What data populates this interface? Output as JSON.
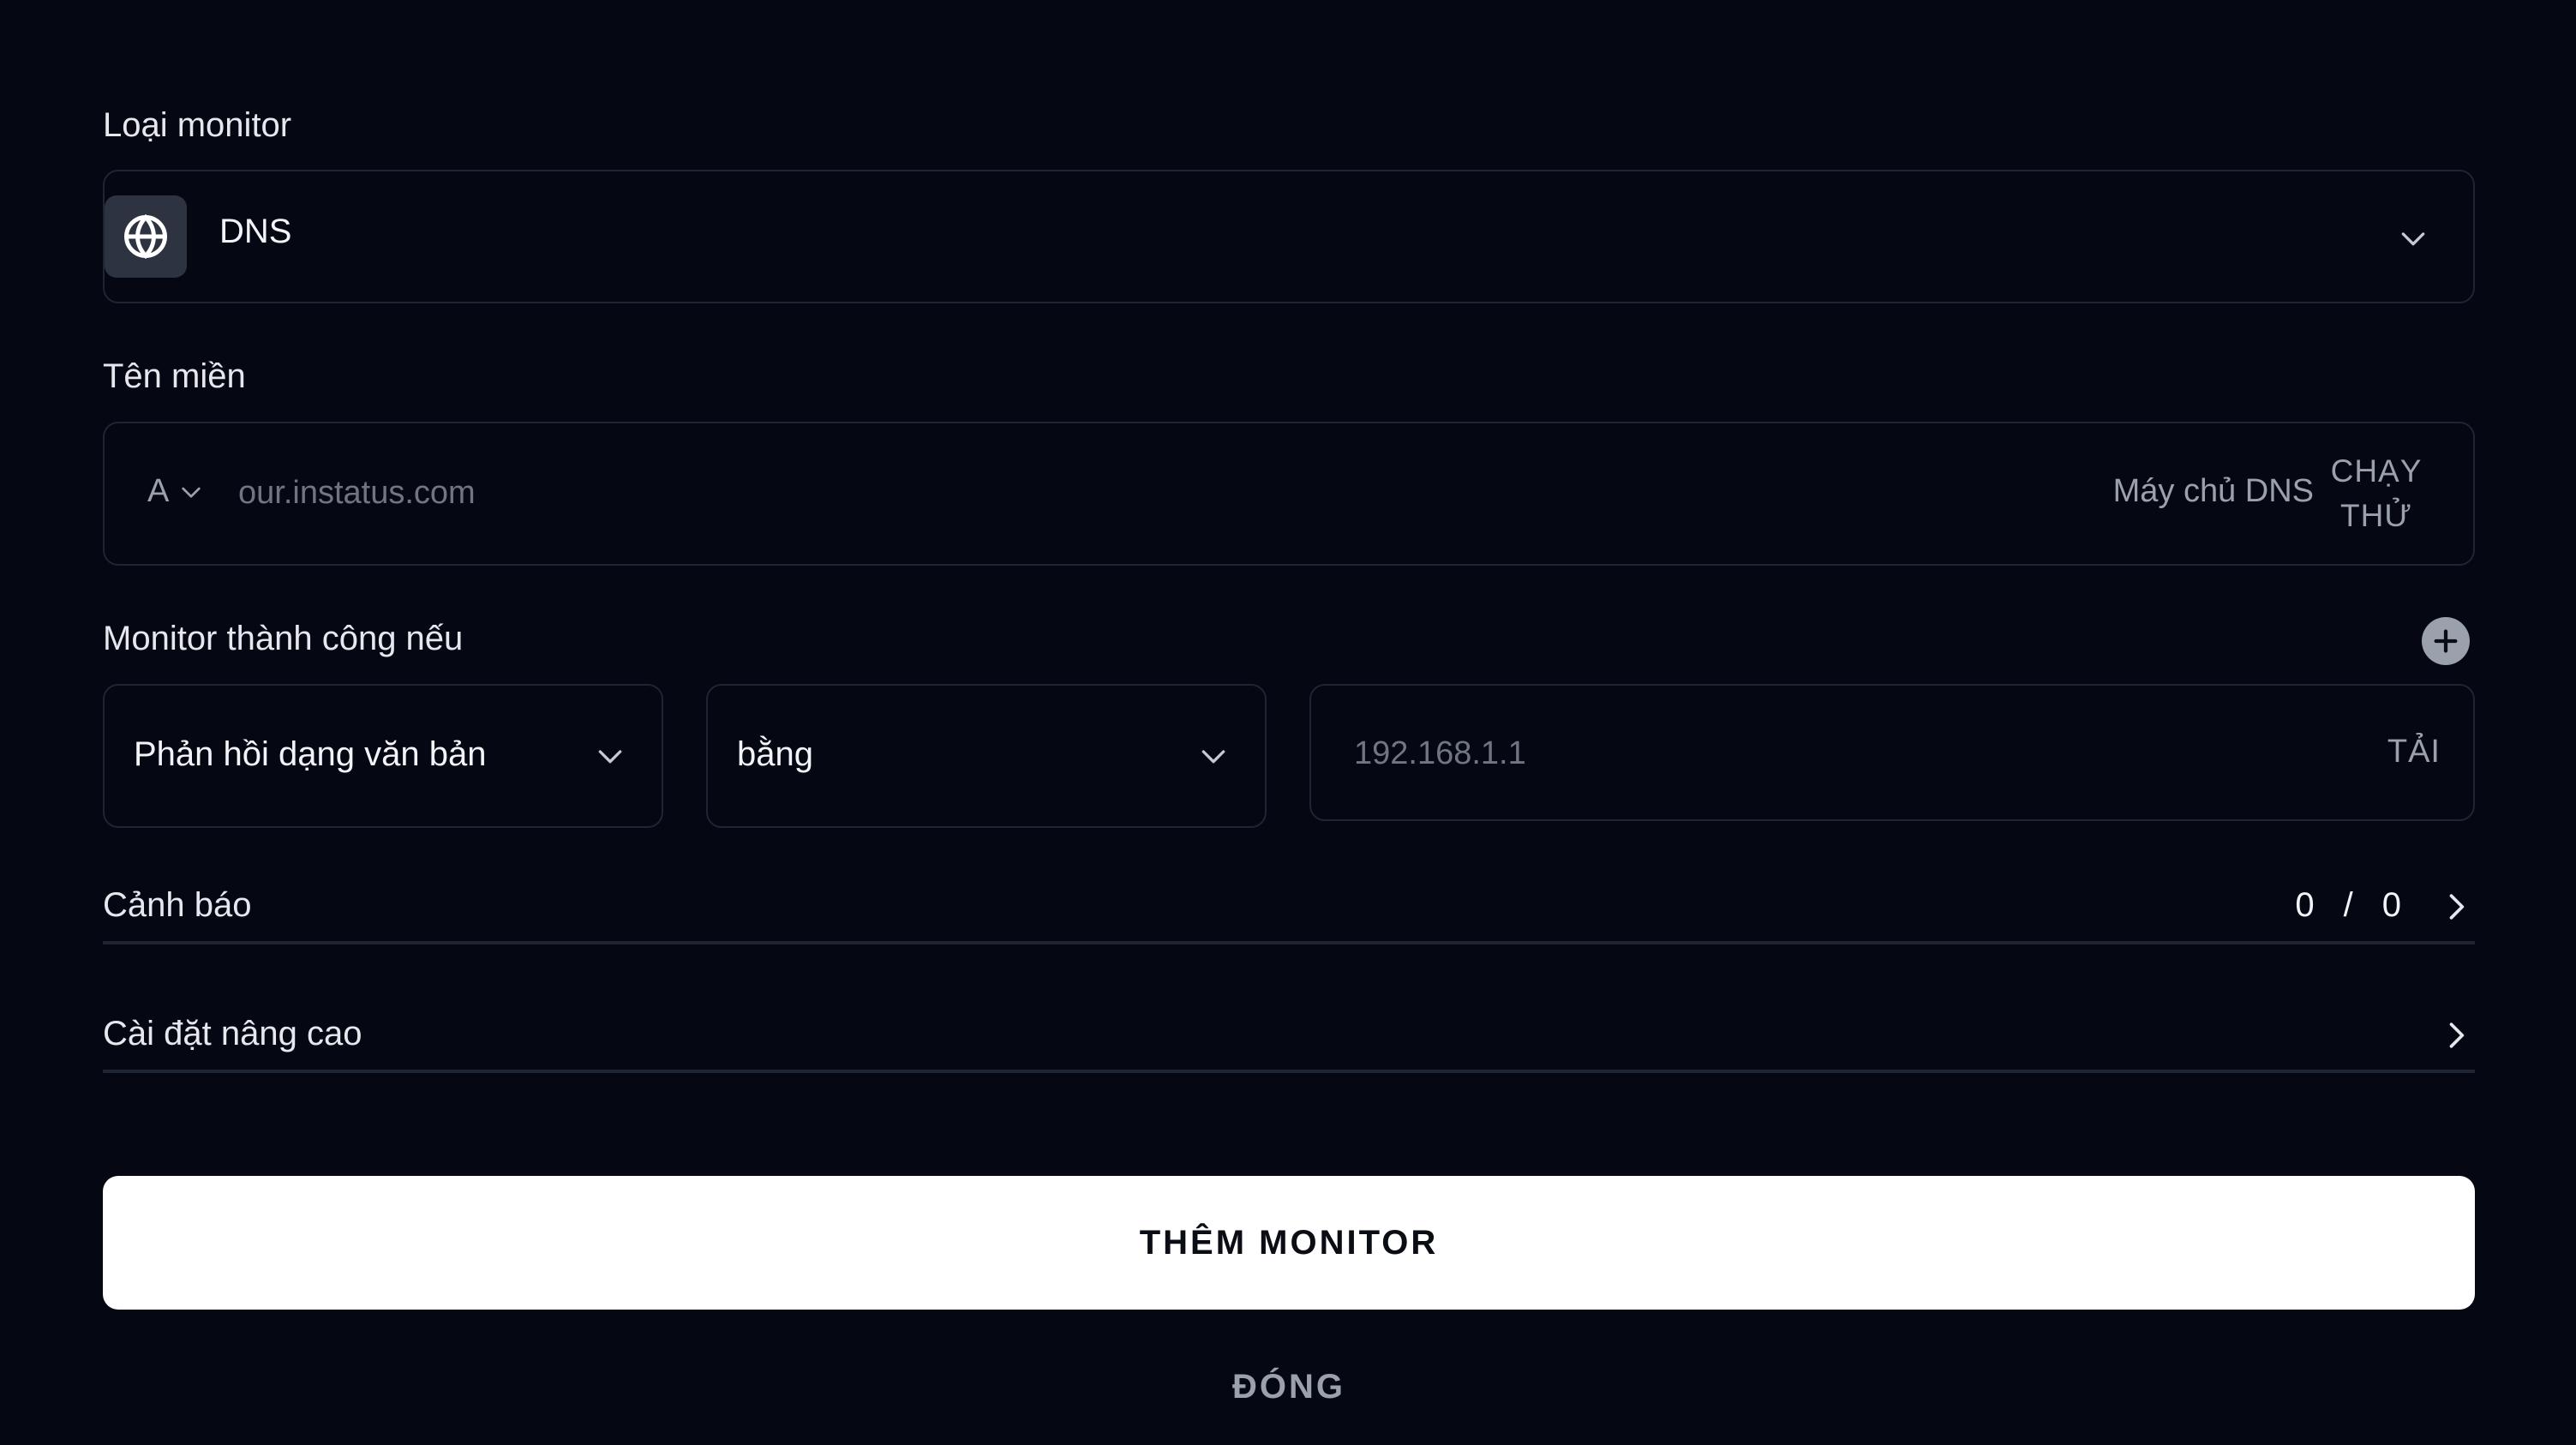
{
  "monitor_type": {
    "label": "Loại monitor",
    "value": "DNS",
    "icon": "globe-icon"
  },
  "domain": {
    "label": "Tên miền",
    "record_type": "A",
    "placeholder": "our.instatus.com",
    "value": "",
    "dns_server_label": "Máy chủ DNS",
    "run_test_line1": "CHẠY",
    "run_test_line2": "THỬ"
  },
  "success_condition": {
    "label": "Monitor thành công nếu",
    "response_type": "Phản hồi dạng văn bản",
    "operator": "bằng",
    "value_placeholder": "192.168.1.1",
    "value": "",
    "load_label": "TẢI"
  },
  "alerts": {
    "label": "Cảnh báo",
    "count_left": "0",
    "separator": "/",
    "count_right": "0"
  },
  "advanced": {
    "label": "Cài đặt nâng cao"
  },
  "actions": {
    "submit_label": "THÊM MONITOR",
    "close_label": "ĐÓNG"
  },
  "colors": {
    "background": "#050812",
    "border": "#1f2533",
    "muted_text": "#9aa0ac",
    "primary_button": "#ffffff"
  }
}
